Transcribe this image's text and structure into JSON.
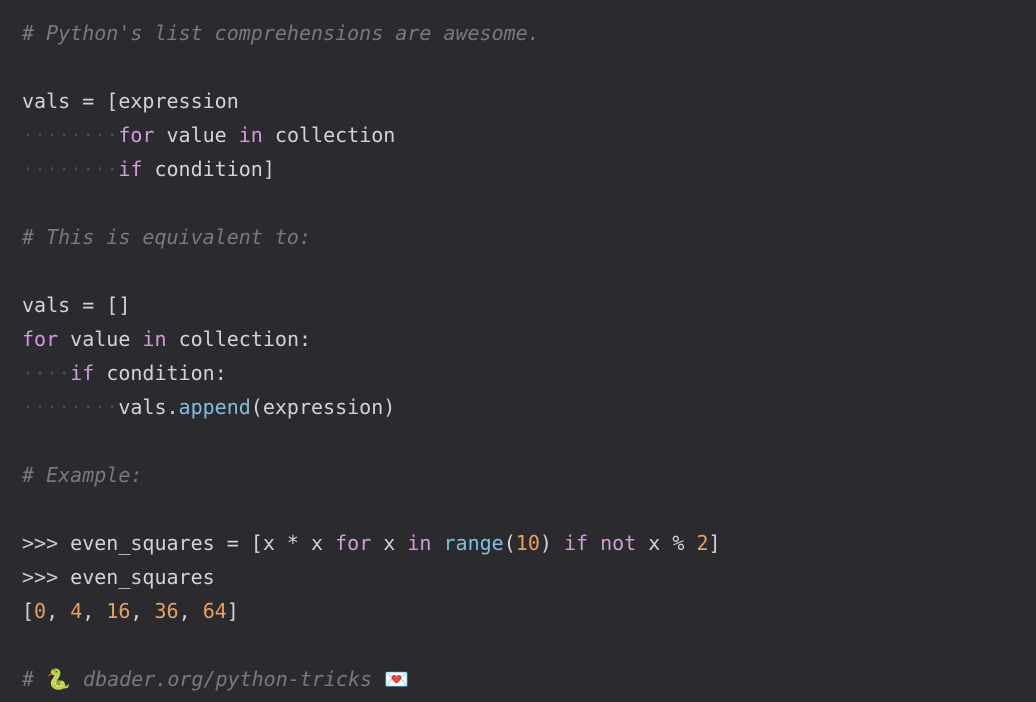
{
  "comments": {
    "c1": "# Python's list comprehensions are awesome.",
    "c2": "# This is equivalent to:",
    "c3": "# Example:",
    "c4_prefix": "# ",
    "c4_emoji1": "🐍",
    "c4_text": " dbader.org/python-tricks ",
    "c4_emoji2": "💌"
  },
  "kw": {
    "for": "for",
    "in": "in",
    "if": "if",
    "not": "not"
  },
  "code": {
    "vals": "vals",
    "eq": " = ",
    "lb": "[",
    "rb": "]",
    "expression": "expression",
    "value": "value",
    "collection": "collection",
    "condition": "condition",
    "colon": ":",
    "dot": ".",
    "append": "append",
    "lp": "(",
    "rp": ")",
    "dots4": "····",
    "dots8": "········",
    "space": " ",
    "empty_lb_rb": "[]",
    "prompt": ">>> ",
    "even_squares": "even_squares",
    "x": "x",
    "star": " * ",
    "range": "range",
    "ten": "10",
    "mod": " % ",
    "two": "2",
    "r0": "0",
    "r1": "4",
    "r2": "16",
    "r3": "36",
    "r4": "64",
    "comma": ", "
  }
}
